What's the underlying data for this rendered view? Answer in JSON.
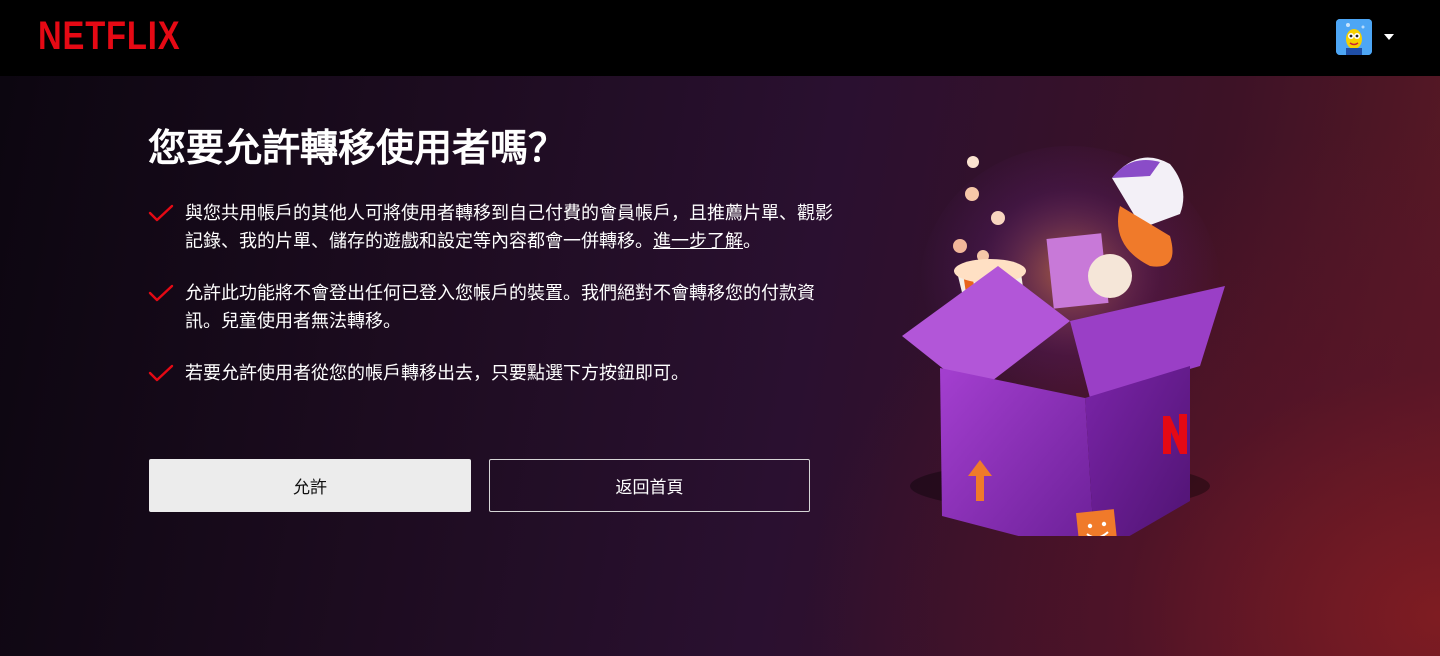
{
  "header": {
    "logo_text": "NETFLIX",
    "profile_avatar_icon": "profile-avatar-icon",
    "profile_menu_icon": "caret-down-icon"
  },
  "main": {
    "title": "您要允許轉移使用者嗎？",
    "bullets": [
      {
        "text_before_link": "與您共用帳戶的其他人可將使用者轉移到自己付費的會員帳戶，且推薦片單、觀影記錄、我的片單、儲存的遊戲和設定等內容都會一併轉移。",
        "link": "進一步了解",
        "text_after_link": "。"
      },
      {
        "text": "允許此功能將不會登出任何已登入您帳戶的裝置。我們絕對不會轉移您的付款資訊。兒童使用者無法轉移。"
      },
      {
        "text": "若要允許使用者從您的帳戶轉移出去，只要點選下方按鈕即可。"
      }
    ],
    "check_icon": "checkmark-icon",
    "buttons": {
      "allow": "允許",
      "back_home": "返回首頁"
    }
  },
  "colors": {
    "brand_red": "#e50914",
    "background": "#000000",
    "allow_button_bg": "#ececec",
    "box_purple": "#8a2fb8"
  }
}
